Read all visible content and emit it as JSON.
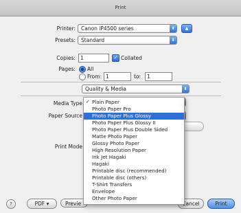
{
  "window": {
    "title": "Print"
  },
  "printer": {
    "label": "Printer:",
    "value": "Canon iP4500 series"
  },
  "presets": {
    "label": "Presets:",
    "value": "Standard"
  },
  "copies": {
    "label": "Copies:",
    "value": "1",
    "collated_label": "Collated",
    "collated_checked": true
  },
  "pages": {
    "label": "Pages:",
    "all_label": "All",
    "from_label": "From:",
    "from_value": "1",
    "to_label": "to:",
    "to_value": "1",
    "selected": "All"
  },
  "panel": {
    "value": "Quality & Media"
  },
  "media_type": {
    "label": "Media Type"
  },
  "paper_source": {
    "label": "Paper Source"
  },
  "print_mode": {
    "label": "Print Mode"
  },
  "media_menu": {
    "items": [
      {
        "label": "Plain Paper",
        "checked": true
      },
      {
        "label": "Photo Paper Pro"
      },
      {
        "label": "Photo Paper Plus Glossy",
        "highlighted": true
      },
      {
        "label": "Photo Paper Plus Glossy II"
      },
      {
        "label": "Photo Paper Plus Double Sided"
      },
      {
        "label": "Matte Photo Paper"
      },
      {
        "label": "Glossy Photo Paper"
      },
      {
        "label": "High Resolution Paper"
      },
      {
        "label": "Ink Jet Hagaki"
      },
      {
        "label": "Hagaki"
      },
      {
        "label": "Printable disc (recommended)"
      },
      {
        "label": "Printable disc (others)"
      },
      {
        "label": "T-Shirt Transfers"
      },
      {
        "label": "Envelope"
      },
      {
        "label": "Other Photo Paper"
      }
    ],
    "check_glyph": "✓"
  },
  "footer": {
    "help": "?",
    "pdf": "PDF ▾",
    "preview": "Previe",
    "cancel": "Cancel",
    "print": "Print"
  },
  "colors": {
    "accent": "#2f6fd8",
    "window_bg": "#f0f0f0"
  }
}
